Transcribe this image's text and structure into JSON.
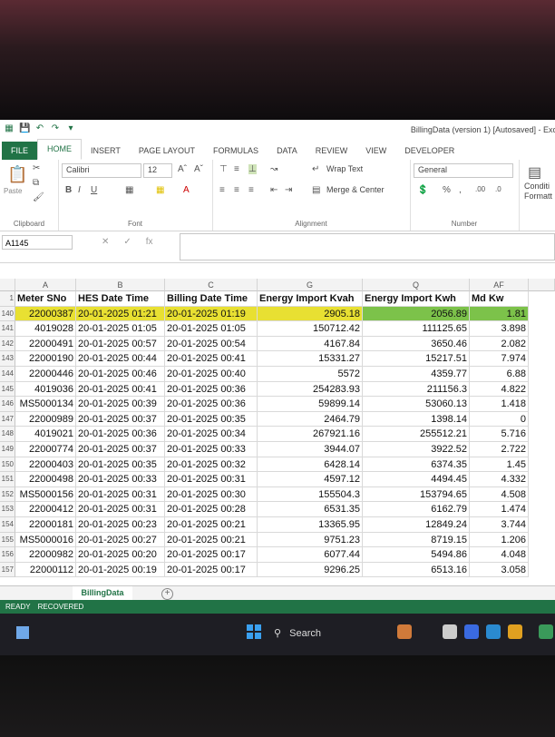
{
  "window": {
    "title": "BillingData (version 1) [Autosaved] - Exc"
  },
  "ribbon": {
    "tabs": [
      "FILE",
      "HOME",
      "INSERT",
      "PAGE LAYOUT",
      "FORMULAS",
      "DATA",
      "REVIEW",
      "VIEW",
      "DEVELOPER"
    ],
    "paste_label": "Paste",
    "clipboard_label": "Clipboard",
    "font_name": "Calibri",
    "font_size": "12",
    "font_group_label": "Font",
    "wrap_text": "Wrap Text",
    "merge_center": "Merge & Center",
    "alignment_label": "Alignment",
    "number_format": "General",
    "number_label": "Number",
    "conditional_formatting": "Conditi Formatt"
  },
  "formula_bar": {
    "name_box": "A1145",
    "fx": "fx",
    "formula": ""
  },
  "columns": [
    "A",
    "B",
    "C",
    "G",
    "Q",
    "AF"
  ],
  "header_row": {
    "row_number": "1",
    "cells": [
      "Meter SNo",
      "HES Date Time",
      "Billing Date Time",
      "Energy Import Kvah",
      "Energy Import Kwh",
      "Md Kw"
    ]
  },
  "rows": [
    {
      "rn": "140",
      "cells": [
        "22000387",
        "20-01-2025 01:21",
        "20-01-2025 01:19",
        "2905.18",
        "2056.89",
        "1.81"
      ]
    },
    {
      "rn": "141",
      "cells": [
        "4019028",
        "20-01-2025 01:05",
        "20-01-2025 01:05",
        "150712.42",
        "111125.65",
        "3.898"
      ]
    },
    {
      "rn": "142",
      "cells": [
        "22000491",
        "20-01-2025 00:57",
        "20-01-2025 00:54",
        "4167.84",
        "3650.46",
        "2.082"
      ]
    },
    {
      "rn": "143",
      "cells": [
        "22000190",
        "20-01-2025 00:44",
        "20-01-2025 00:41",
        "15331.27",
        "15217.51",
        "7.974"
      ]
    },
    {
      "rn": "144",
      "cells": [
        "22000446",
        "20-01-2025 00:46",
        "20-01-2025 00:40",
        "5572",
        "4359.77",
        "6.88"
      ]
    },
    {
      "rn": "145",
      "cells": [
        "4019036",
        "20-01-2025 00:41",
        "20-01-2025 00:36",
        "254283.93",
        "211156.3",
        "4.822"
      ]
    },
    {
      "rn": "146",
      "cells": [
        "MS5000134",
        "20-01-2025 00:39",
        "20-01-2025 00:36",
        "59899.14",
        "53060.13",
        "1.418"
      ]
    },
    {
      "rn": "147",
      "cells": [
        "22000989",
        "20-01-2025 00:37",
        "20-01-2025 00:35",
        "2464.79",
        "1398.14",
        "0"
      ]
    },
    {
      "rn": "148",
      "cells": [
        "4019021",
        "20-01-2025 00:36",
        "20-01-2025 00:34",
        "267921.16",
        "255512.21",
        "5.716"
      ]
    },
    {
      "rn": "149",
      "cells": [
        "22000774",
        "20-01-2025 00:37",
        "20-01-2025 00:33",
        "3944.07",
        "3922.52",
        "2.722"
      ]
    },
    {
      "rn": "150",
      "cells": [
        "22000403",
        "20-01-2025 00:35",
        "20-01-2025 00:32",
        "6428.14",
        "6374.35",
        "1.45"
      ]
    },
    {
      "rn": "151",
      "cells": [
        "22000498",
        "20-01-2025 00:33",
        "20-01-2025 00:31",
        "4597.12",
        "4494.45",
        "4.332"
      ]
    },
    {
      "rn": "152",
      "cells": [
        "MS5000156",
        "20-01-2025 00:31",
        "20-01-2025 00:30",
        "155504.3",
        "153794.65",
        "4.508"
      ]
    },
    {
      "rn": "153",
      "cells": [
        "22000412",
        "20-01-2025 00:31",
        "20-01-2025 00:28",
        "6531.35",
        "6162.79",
        "1.474"
      ]
    },
    {
      "rn": "154",
      "cells": [
        "22000181",
        "20-01-2025 00:23",
        "20-01-2025 00:21",
        "13365.95",
        "12849.24",
        "3.744"
      ]
    },
    {
      "rn": "155",
      "cells": [
        "MS5000016",
        "20-01-2025 00:27",
        "20-01-2025 00:21",
        "9751.23",
        "8719.15",
        "1.206"
      ]
    },
    {
      "rn": "156",
      "cells": [
        "22000982",
        "20-01-2025 00:20",
        "20-01-2025 00:17",
        "6077.44",
        "5494.86",
        "4.048"
      ]
    },
    {
      "rn": "157",
      "cells": [
        "22000112",
        "20-01-2025 00:19",
        "20-01-2025 00:17",
        "9296.25",
        "6513.16",
        "3.058"
      ]
    }
  ],
  "sheet_tab": "BillingData",
  "status": {
    "ready": "READY",
    "recovered": "RECOVERED"
  },
  "taskbar": {
    "search_label": "Search"
  }
}
